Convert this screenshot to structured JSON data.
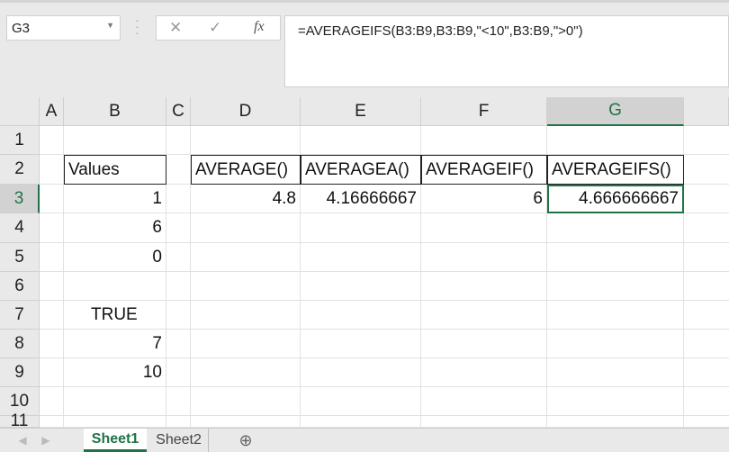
{
  "formula_bar": {
    "name_box": "G3",
    "cancel_icon": "✕",
    "enter_icon": "✓",
    "fx_label": "fx",
    "formula": "=AVERAGEIFS(B3:B9,B3:B9,\"<10\",B3:B9,\">0\")"
  },
  "columns": [
    "A",
    "B",
    "C",
    "D",
    "E",
    "F",
    "G"
  ],
  "rows": [
    "1",
    "2",
    "3",
    "4",
    "5",
    "6",
    "7",
    "8",
    "9",
    "10",
    "11"
  ],
  "cells": {
    "B2": "Values",
    "B3": "1",
    "B4": "6",
    "B5": "0",
    "B7": "TRUE",
    "B8": "7",
    "B9": "10",
    "D2": "AVERAGE()",
    "E2": "AVERAGEA()",
    "F2": "AVERAGEIF()",
    "G2": "AVERAGEIFS()",
    "D3": "4.8",
    "E3": "4.16666667",
    "F3": "6",
    "G3": "4.666666667"
  },
  "tabs": [
    {
      "label": "Sheet1",
      "active": true
    },
    {
      "label": "Sheet2",
      "active": false
    }
  ],
  "accent": "#217346"
}
